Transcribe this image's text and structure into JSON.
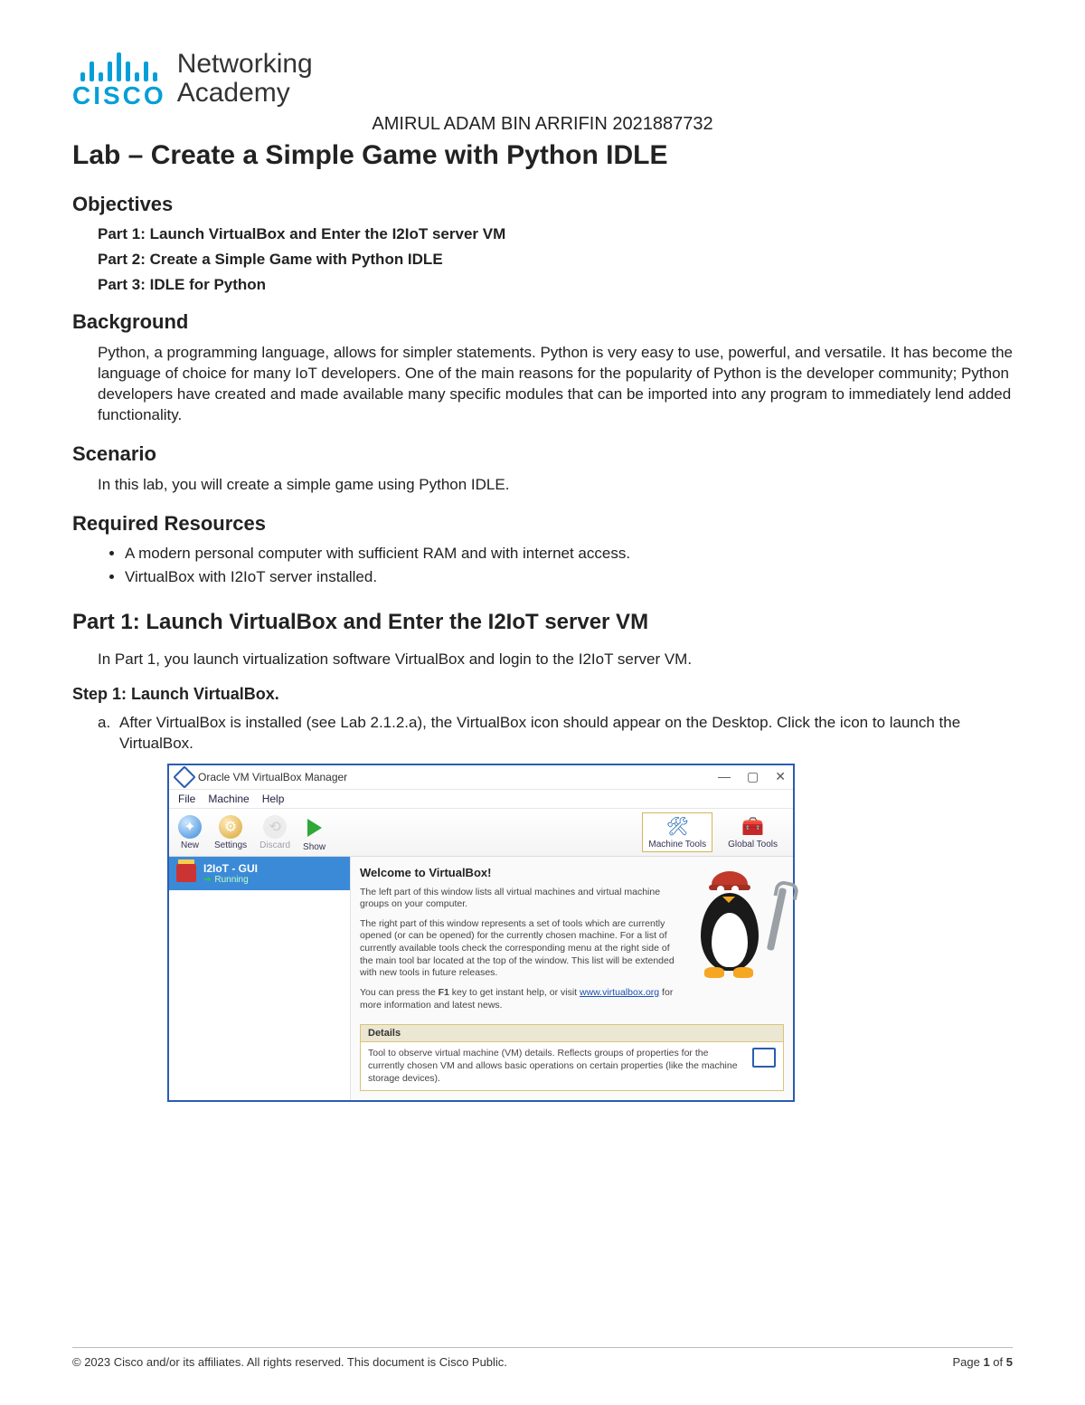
{
  "logo": {
    "brand": "CISCO",
    "line1": "Networking",
    "line2": "Academy"
  },
  "student_line": "AMIRUL ADAM BIN ARRIFIN 2021887732",
  "lab_title": "Lab – Create a Simple Game with Python IDLE",
  "objectives": {
    "heading": "Objectives",
    "items": [
      "Part 1: Launch VirtualBox and Enter the I2IoT server VM",
      "Part 2: Create a Simple Game with Python IDLE",
      "Part 3: IDLE for Python"
    ]
  },
  "background": {
    "heading": "Background",
    "text": "Python, a programming language, allows for simpler statements. Python is very easy to use, powerful, and versatile. It has become the language of choice for many IoT developers. One of the main reasons for the popularity of Python is the developer community; Python developers have created and made available many specific modules that can be imported into any program to immediately lend added functionality."
  },
  "scenario": {
    "heading": "Scenario",
    "text": "In this lab, you will create a simple game using Python IDLE."
  },
  "resources": {
    "heading": "Required Resources",
    "items": [
      "A modern personal computer with sufficient RAM and with internet access.",
      "VirtualBox with I2IoT server installed."
    ]
  },
  "part1": {
    "heading": "Part 1:   Launch VirtualBox and Enter the I2IoT server VM",
    "intro": "In Part 1, you launch virtualization software VirtualBox and login to the I2IoT server VM.",
    "step1_heading": "Step 1:  Launch VirtualBox.",
    "step1_a": "After VirtualBox is installed (see Lab 2.1.2.a), the VirtualBox icon should appear on the Desktop. Click the icon to launch the VirtualBox."
  },
  "vbox": {
    "title": "Oracle VM VirtualBox Manager",
    "menu": {
      "file": "File",
      "machine": "Machine",
      "help": "Help"
    },
    "toolbar": {
      "new": "New",
      "settings": "Settings",
      "discard": "Discard",
      "show": "Show",
      "machine_tools": "Machine Tools",
      "global_tools": "Global Tools"
    },
    "vm": {
      "name": "I2IoT - GUI",
      "state": "Running"
    },
    "welcome": {
      "heading": "Welcome to VirtualBox!",
      "p1": "The left part of this window lists all virtual machines and virtual machine groups on your computer.",
      "p2": "The right part of this window represents a set of tools which are currently opened (or can be opened) for the currently chosen machine. For a list of currently available tools check the corresponding menu at the right side of the main tool bar located at the top of the window. This list will be extended with new tools in future releases.",
      "p3_pre": "You can press the ",
      "p3_key": "F1",
      "p3_mid": " key to get instant help, or visit ",
      "p3_link": "www.virtualbox.org",
      "p3_post": " for more information and latest news."
    },
    "details": {
      "heading": "Details",
      "text": "Tool to observe virtual machine (VM) details. Reflects groups of properties for the currently chosen VM and allows basic operations on certain properties (like the machine storage devices)."
    }
  },
  "footer": {
    "copyright": "© 2023 Cisco and/or its affiliates. All rights reserved. This document is Cisco Public.",
    "page_label_pre": "Page ",
    "page_current": "1",
    "page_of": " of ",
    "page_total": "5"
  }
}
